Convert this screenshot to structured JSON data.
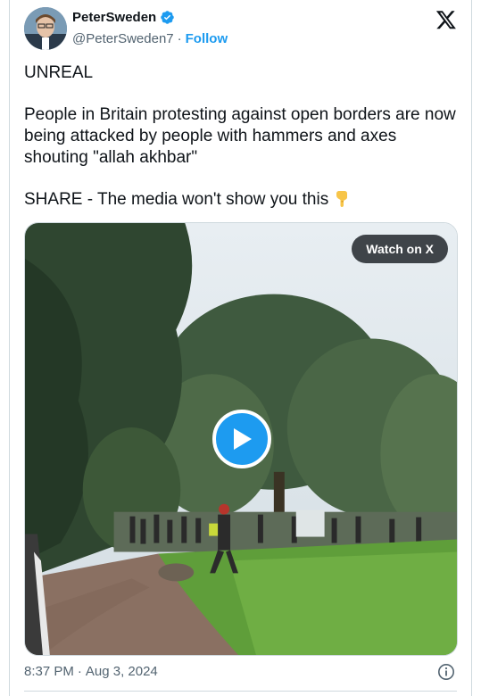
{
  "header": {
    "display_name": "PeterSweden",
    "handle": "@PeterSweden7",
    "separator": "·",
    "follow_label": "Follow",
    "verified_icon": "verified-badge-icon",
    "platform_icon": "x-logo-icon"
  },
  "tweet": {
    "line1": "UNREAL",
    "line2": "People in Britain protesting against open borders are now being attacked by people with hammers and axes shouting \"allah akhbar\"",
    "line3": "SHARE - The media won't show you this",
    "emoji": "backhand-index-pointing-down"
  },
  "media": {
    "watch_label": "Watch on X",
    "play_icon": "play-icon"
  },
  "footer": {
    "time": "8:37 PM",
    "separator": "·",
    "date": "Aug 3, 2024",
    "info_icon": "info-icon"
  },
  "colors": {
    "accent": "#1d9bf0",
    "text": "#0f1419",
    "muted": "#536471",
    "border": "#cfd9de"
  }
}
